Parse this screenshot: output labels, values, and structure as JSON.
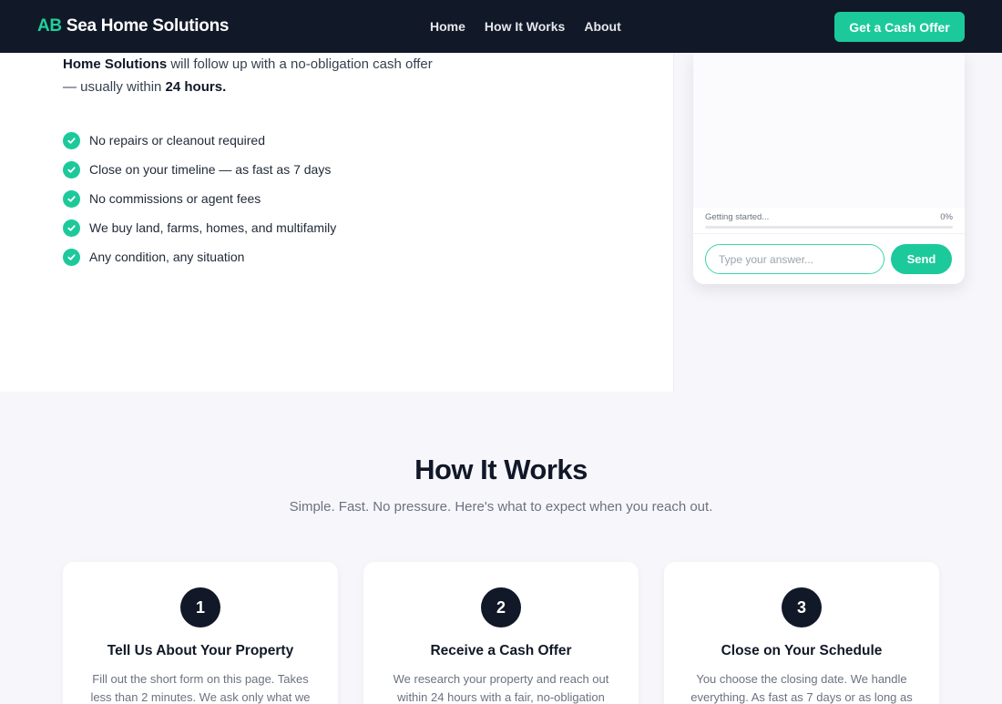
{
  "brand": {
    "initials": "AB",
    "name": "Sea Home Solutions",
    "accent": "#1cc99b",
    "dark": "#111827"
  },
  "nav": {
    "links": [
      "Home",
      "How It Works",
      "About"
    ],
    "cta": "Get a Cash Offer"
  },
  "hero": {
    "intro_bold": "Home Solutions",
    "intro_mid": " will follow up with a no-obligation cash offer — usually within ",
    "intro_end": "24 hours.",
    "checklist": [
      "No repairs or cleanout required",
      "Close on your timeline — as fast as 7 days",
      "No commissions or agent fees",
      "We buy land, farms, homes, and multifamily",
      "Any condition, any situation"
    ]
  },
  "chat": {
    "status": "Getting started...",
    "progress_label": "0%",
    "progress": 0,
    "placeholder": "Type your answer...",
    "send": "Send"
  },
  "how_it_works": {
    "title": "How It Works",
    "subtitle": "Simple. Fast. No pressure. Here's what to expect when you reach out.",
    "steps": [
      {
        "num": "1",
        "title": "Tell Us About Your Property",
        "text": "Fill out the short form on this page. Takes less than 2 minutes. We ask only what we"
      },
      {
        "num": "2",
        "title": "Receive a Cash Offer",
        "text": "We research your property and reach out within 24 hours with a fair, no-obligation"
      },
      {
        "num": "3",
        "title": "Close on Your Schedule",
        "text": "You choose the closing date. We handle everything. As fast as 7 days or as long as"
      }
    ]
  }
}
